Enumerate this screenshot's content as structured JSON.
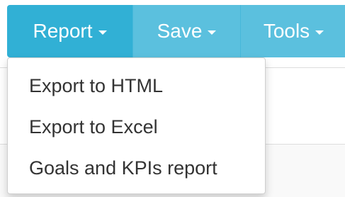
{
  "toolbar": {
    "buttons": [
      {
        "label": "Report",
        "state": "open"
      },
      {
        "label": "Save"
      },
      {
        "label": "Tools"
      }
    ]
  },
  "report_menu": {
    "items": [
      {
        "label": "Export to HTML"
      },
      {
        "label": "Export to Excel"
      },
      {
        "label": "Goals and KPIs report"
      }
    ]
  },
  "colors": {
    "button_bg": "#5bc0de",
    "button_active_bg": "#31b0d5",
    "menu_text": "#333333"
  },
  "icons": {
    "caret": "caret-down-icon"
  }
}
